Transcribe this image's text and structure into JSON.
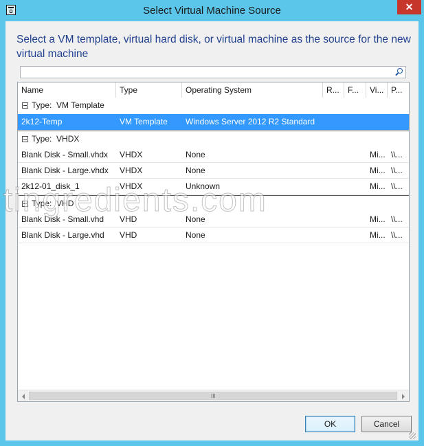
{
  "window": {
    "title": "Select Virtual Machine Source",
    "close_label": "✕"
  },
  "instruction": "Select a VM template, virtual hard disk, or virtual machine as the source for the new virtual machine",
  "search": {
    "value": "",
    "placeholder": ""
  },
  "grid": {
    "columns": [
      "Name",
      "Type",
      "Operating System",
      "R...",
      "F...",
      "Vi...",
      "P..."
    ],
    "groups": [
      {
        "label": "Type:  VM Template",
        "rows": [
          {
            "name": "2k12-Temp",
            "type": "VM Template",
            "os": "Windows Server 2012 R2 Standard",
            "r": "",
            "f": "",
            "vi": "",
            "p": "",
            "selected": true
          }
        ]
      },
      {
        "label": "Type:  VHDX",
        "rows": [
          {
            "name": "Blank Disk - Small.vhdx",
            "type": "VHDX",
            "os": "None",
            "r": "",
            "f": "",
            "vi": "Mi...",
            "p": "\\\\..."
          },
          {
            "name": "Blank Disk - Large.vhdx",
            "type": "VHDX",
            "os": "None",
            "r": "",
            "f": "",
            "vi": "Mi...",
            "p": "\\\\..."
          },
          {
            "name": "2k12-01_disk_1",
            "type": "VHDX",
            "os": "Unknown",
            "r": "",
            "f": "",
            "vi": "Mi...",
            "p": "\\\\..."
          }
        ]
      },
      {
        "label": "Type:  VHD",
        "rows": [
          {
            "name": "Blank Disk - Small.vhd",
            "type": "VHD",
            "os": "None",
            "r": "",
            "f": "",
            "vi": "Mi...",
            "p": "\\\\..."
          },
          {
            "name": "Blank Disk - Large.vhd",
            "type": "VHD",
            "os": "None",
            "r": "",
            "f": "",
            "vi": "Mi...",
            "p": "\\\\..."
          }
        ]
      }
    ],
    "scroll_grip": "III"
  },
  "watermark": "itingredients.com",
  "buttons": {
    "ok": "OK",
    "cancel": "Cancel"
  },
  "colors": {
    "accent": "#5bc6ea",
    "selection": "#3399ff",
    "close": "#c7362b",
    "instruction_text": "#1f3f8f"
  }
}
